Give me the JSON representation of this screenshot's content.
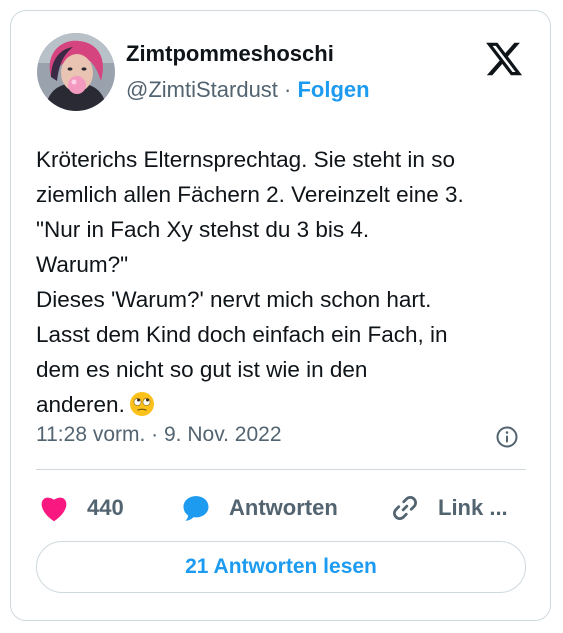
{
  "author": {
    "name": "Zimtpommeshoschi",
    "handle": "@ZimtiStardust",
    "separator": " · ",
    "follow_label": "Folgen"
  },
  "tweet": {
    "lines": [
      "Kröterichs Elternsprechtag. Sie steht in so",
      "ziemlich allen Fächern 2. Vereinzelt eine 3.",
      "\"Nur in Fach Xy stehst du 3 bis 4.",
      "Warum?\"",
      "Dieses 'Warum?' nervt mich schon hart.",
      "Lasst dem Kind doch einfach ein Fach, in",
      "dem es nicht so gut ist wie in den",
      "anderen."
    ],
    "emoji": "face-with-rolling-eyes-emoji"
  },
  "meta": {
    "time": "11:28 vorm.",
    "separator": " · ",
    "date": "9. Nov. 2022"
  },
  "actions": {
    "like_count": "440",
    "reply_label": "Antworten",
    "link_label": "Link ..."
  },
  "read_replies_label": "21 Antworten lesen",
  "colors": {
    "accent": "#1d9bf0",
    "like": "#f91880",
    "text": "#0f1419",
    "muted": "#536471",
    "border": "#cfd9de"
  },
  "icons": [
    "x-logo-icon",
    "heart-icon",
    "reply-bubble-icon",
    "link-icon",
    "info-icon"
  ]
}
